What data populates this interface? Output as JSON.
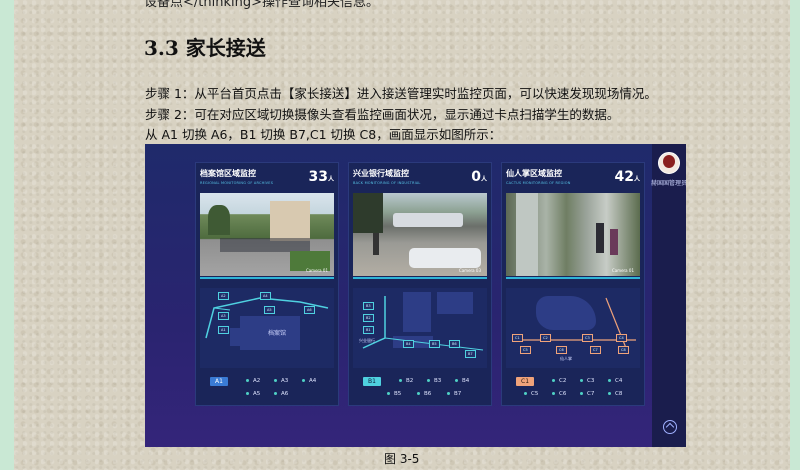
{
  "doc": {
    "top_cut_text": "设备点</thinking>操作查询相关信息。",
    "heading": "3.3 家长接送",
    "step1": "步骤 1：从平台首页点击【家长接送】进入接送管理实时监控页面，可以快速发现现场情况。",
    "step2": "步骤 2：可在对应区域切换摄像头查看监控画面状况，显示通过卡点扫描学生的数据。",
    "step3": "从 A1 切换 A6，B1 切换 B7,C1 切换 C8，画面显示如图所示：",
    "caption": "图 3-5"
  },
  "screen": {
    "user_name": "赫国国管理员",
    "panels": [
      {
        "title": "档案馆区域监控",
        "subtitle": "REGIONAL MONITORING OF ARCHIVES",
        "count": "33",
        "unit": "人",
        "camera": "Camera 01",
        "map_label": "档案馆",
        "active": "A1",
        "gates": [
          "A2",
          "A3",
          "A4",
          "A5",
          "A6"
        ],
        "active_color": "#3a7bd5",
        "nodes": [
          "A2",
          "A4",
          "A1",
          "A3",
          "A5",
          "A6"
        ]
      },
      {
        "title": "兴业银行域监控",
        "subtitle": "BACK MONITORING OF INDUSTRIAL",
        "count": "0",
        "unit": "人",
        "camera": "Camera 03",
        "map_label": "兴业银行",
        "active": "B1",
        "gates": [
          "B2",
          "B3",
          "B4",
          "B5",
          "B6",
          "B7"
        ],
        "active_color": "#4fd1e0",
        "nodes": [
          "B3",
          "B2",
          "B1",
          "B4",
          "B5",
          "B6",
          "B7"
        ]
      },
      {
        "title": "仙人掌区域监控",
        "subtitle": "CACTUS MONITORING OF REGION",
        "count": "42",
        "unit": "人",
        "camera": "Camera 01",
        "map_label": "仙人掌",
        "active": "C1",
        "gates": [
          "C2",
          "C3",
          "C4",
          "C5",
          "C6",
          "C7",
          "C8"
        ],
        "active_color": "#f0a37a",
        "nodes": [
          "C1",
          "C2",
          "C3",
          "C4",
          "C5",
          "C6",
          "C7",
          "C8"
        ]
      }
    ]
  }
}
